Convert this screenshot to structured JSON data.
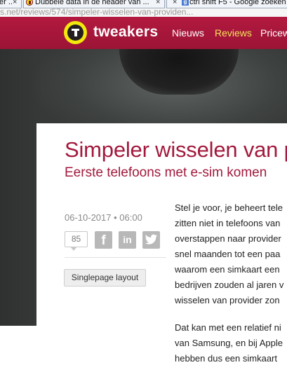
{
  "browser": {
    "tabs": [
      {
        "label": "er ...",
        "close": "×"
      },
      {
        "label": "Dubbele data in de header van ...",
        "close": "×"
      },
      {
        "label": "ctrl shift F5 - Google zoeken",
        "close": "×"
      }
    ],
    "google_favicon": "g",
    "url": "s.net/reviews/574/simpeler-wisselen-van-providen..."
  },
  "header": {
    "logo_text": "tweakers",
    "nav": [
      "Nieuws",
      "Reviews",
      "Pricew"
    ],
    "active_nav": "Reviews",
    "colors": {
      "brand": "#a8163a",
      "logo_yellow": "#f2e80c",
      "active_nav": "#f6e25c"
    }
  },
  "article": {
    "title": "Simpeler wisselen van pr",
    "subtitle": "Eerste telefoons met e-sim komen",
    "date": "06-10-2017 • 06:00",
    "comment_count": "85",
    "share_icons": [
      "facebook-icon",
      "linkedin-icon",
      "twitter-icon"
    ],
    "singlepage_label": "Singlepage layout",
    "paragraph1": [
      "Stel je voor, je beheert tele",
      "zitten niet in telefoons van",
      "overstappen naar provider",
      "snel maanden tot een paa",
      "waarom een simkaart een",
      "bedrijven zouden al jaren v",
      "wisselen van provider zon"
    ],
    "paragraph2": [
      "Dat kan met een relatief ni",
      "van Samsung, en bij Apple",
      "hebben dus een simkaart"
    ],
    "colors": {
      "title": "#a21a3d"
    }
  }
}
